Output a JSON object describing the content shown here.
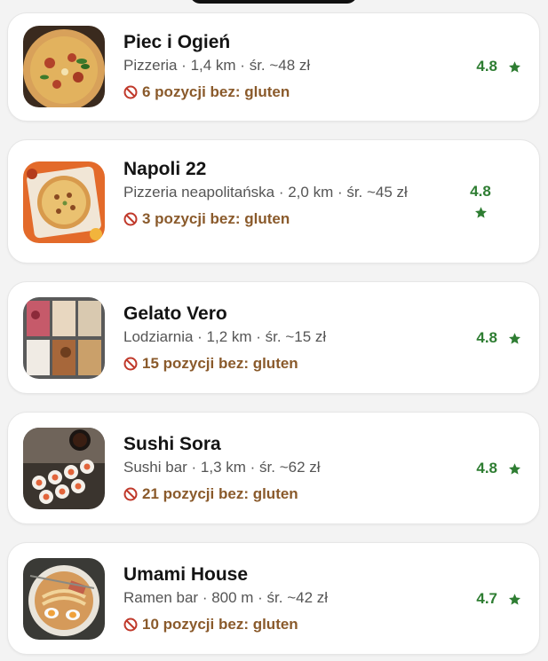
{
  "colors": {
    "rating": "#2e7d32",
    "warning": "#8a5a2b",
    "ban_icon": "#c0392b",
    "name": "#141414",
    "meta": "#555555"
  },
  "restaurants": [
    {
      "name": "Piec i Ogień",
      "meta": "Pizzeria · 1,4 km · śr. ~48 zł",
      "warning": "6 pozycji bez: gluten",
      "rating": "4.8",
      "thumb_icon": "pizza-photo"
    },
    {
      "name": "Napoli 22",
      "meta": "Pizzeria neapolitańska · 2,0 km · śr. ~45 zł",
      "warning": "3 pozycji bez: gluten",
      "rating": "4.8",
      "thumb_icon": "neapolitan-pizza-photo"
    },
    {
      "name": "Gelato Vero",
      "meta": "Lodziarnia · 1,2 km · śr. ~15 zł",
      "warning": "15 pozycji bez: gluten",
      "rating": "4.8",
      "thumb_icon": "gelato-photo"
    },
    {
      "name": "Sushi Sora",
      "meta": "Sushi bar · 1,3 km · śr. ~62 zł",
      "warning": "21 pozycji bez: gluten",
      "rating": "4.8",
      "thumb_icon": "sushi-photo"
    },
    {
      "name": "Umami House",
      "meta": "Ramen bar · 800 m · śr. ~42 zł",
      "warning": "10 pozycji bez: gluten",
      "rating": "4.7",
      "thumb_icon": "ramen-photo"
    }
  ]
}
